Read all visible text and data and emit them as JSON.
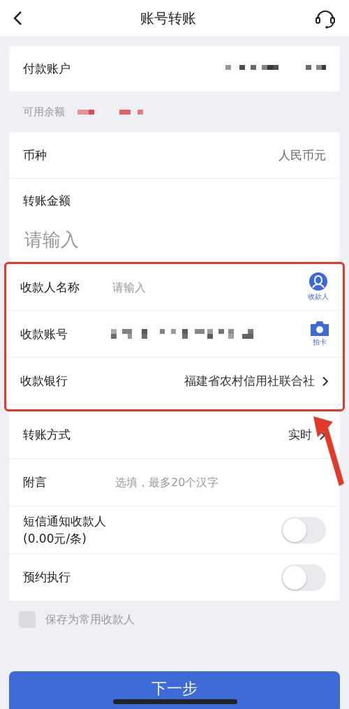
{
  "header": {
    "title": "账号转账"
  },
  "payer": {
    "label": "付款账户"
  },
  "balance": {
    "label": "可用余额"
  },
  "currency": {
    "label": "币种",
    "value": "人民币元"
  },
  "amount": {
    "label": "转账金额",
    "placeholder": "请输入"
  },
  "payee_rows": [
    {
      "kind": "input",
      "label": "收款人名称",
      "placeholder": "请输入",
      "action": {
        "label": "收款人"
      }
    },
    {
      "kind": "masked",
      "label": "收款账号",
      "action": {
        "label": "拍卡"
      }
    },
    {
      "kind": "select",
      "label": "收款银行",
      "value": "福建省农村信用社联合社"
    }
  ],
  "options": [
    {
      "kind": "select",
      "label": "转账方式",
      "value": "实时"
    },
    {
      "kind": "input",
      "label": "附言",
      "placeholder": "选填，最多20个汉字"
    },
    {
      "kind": "toggle",
      "label": "短信通知收款人",
      "sublabel": "(0.00元/条)",
      "on": false
    },
    {
      "kind": "toggle",
      "label": "预约执行",
      "on": false
    }
  ],
  "save": {
    "label": "保存为常用收款人",
    "checked": false
  },
  "next_button": "下一步"
}
